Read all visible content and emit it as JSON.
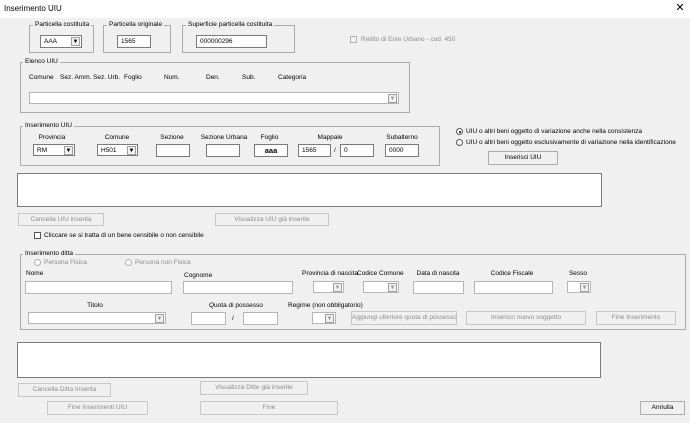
{
  "window": {
    "title": "Inserimento UIU",
    "close_glyph": "✕"
  },
  "particella_costituita": {
    "legend": "Particella costituita",
    "value": "AAA"
  },
  "particella_originale": {
    "legend": "Particella originale",
    "value": "1565"
  },
  "superficie": {
    "legend": "Superficie particella costituita",
    "value": "000000296"
  },
  "relitto": {
    "label": "Relitto di Ente Urbano - cod. 450",
    "checked": false
  },
  "elenco_uiu": {
    "legend": "Elenco UIU",
    "headers": [
      "Comune",
      "Sez. Amm.",
      "Sez. Urb.",
      "Foglio",
      "Num.",
      "Den.",
      "Sub.",
      "Categoria"
    ]
  },
  "inserimento_uiu": {
    "legend": "Inserimento UIU",
    "provincia": {
      "label": "Provincia",
      "value": "RM"
    },
    "comune": {
      "label": "Comune",
      "value": "H501"
    },
    "sezione": {
      "label": "Sezione",
      "value": ""
    },
    "sezione_urbana": {
      "label": "Sezione Urbana",
      "value": ""
    },
    "foglio": {
      "label": "Foglio",
      "value": "aaa"
    },
    "mappale": {
      "label": "Mappale",
      "value": "1565",
      "slash": "/",
      "value2": "0"
    },
    "subalterno": {
      "label": "Subalterno",
      "value": "0000"
    }
  },
  "variazione": {
    "option1": "UIU o altri beni oggetto di variazione anche nella consistenza",
    "option2": "UIU o altri beni oggetto esclusivamente di variazione nella identificazione",
    "selected": 1
  },
  "buttons": {
    "inserisci_uiu": "Inserisci UIU",
    "cancella_uiu": "Cancella UIU inserita",
    "visualizza_uiu": "Visualizza UIU già inserite",
    "aggiungi_quota": "Aggiungi ulteriore quota di possesso",
    "inserisci_soggetto": "Inserisci nuovo soggetto",
    "fine_inserimento": "Fine Inserimento",
    "cancella_ditta": "Cancella Ditta Inserita",
    "visualizza_ditte": "Visualizza Ditte già inserite",
    "fine_inserimenti_uiu": "Fine Inserimenti UIU",
    "fine": "Fine",
    "annulla": "Annulla"
  },
  "bene_sensibile": {
    "label": "Cliccare se si tratta di un bene censibile o non censibile",
    "checked": false
  },
  "inserimento_ditta": {
    "legend": "Inserimento ditta",
    "persona_fisica": "Persona Fisica",
    "persona_non_fisica": "Persona non Fisica",
    "nome": "Nome",
    "cognome": "Cognome",
    "provincia_nascita": "Provincia di nascita",
    "codice_comune": "Codice Comune",
    "data_nascita": "Data di nascita",
    "codice_fiscale": "Codice Fiscale",
    "sesso": "Sesso",
    "titolo": "Titolo",
    "quota": "Quota di possesso",
    "quota_slash": "/",
    "regime": "Regime (non obbligatorio)"
  }
}
